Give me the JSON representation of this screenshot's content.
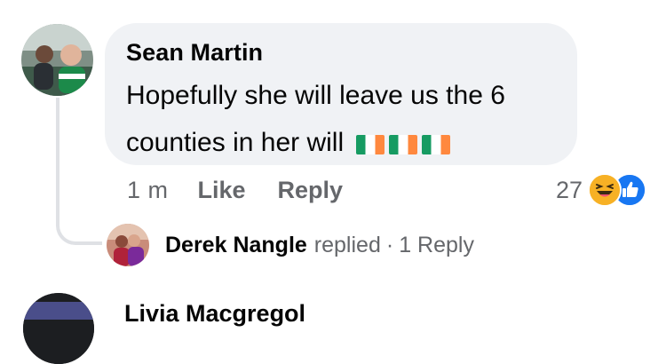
{
  "comment": {
    "author": "Sean Martin",
    "text_line1": "Hopefully she will leave us the 6",
    "text_line2": "counties in her will",
    "flag_emojis": [
      "irish-flag",
      "irish-flag",
      "irish-flag"
    ],
    "colors": {
      "flag_green": "#169b62",
      "flag_white": "#ffffff",
      "flag_orange": "#ff883e"
    }
  },
  "actions": {
    "time": "1 m",
    "like_label": "Like",
    "reply_label": "Reply"
  },
  "reactions": {
    "count": "27",
    "icons": [
      "haha-icon",
      "like-icon"
    ]
  },
  "reply_preview": {
    "name": "Derek Nangle",
    "action": "replied",
    "separator": "·",
    "count_label": "1 Reply"
  },
  "next_comment": {
    "author": "Livia Macgregol"
  }
}
